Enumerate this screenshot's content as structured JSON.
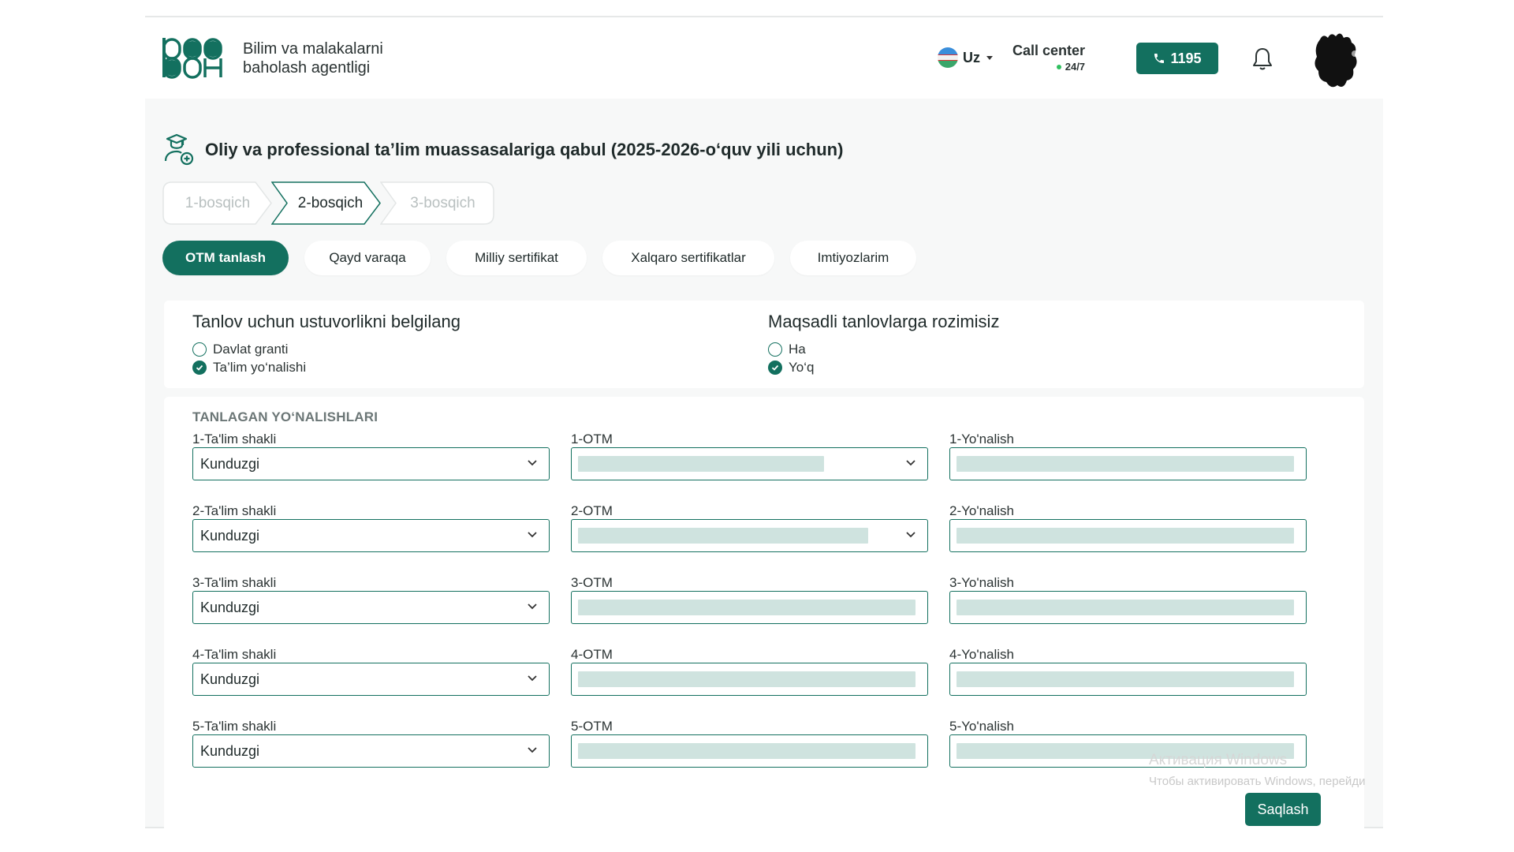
{
  "header": {
    "brand_line1": "Bilim va malakalarni",
    "brand_line2": "baholash agentligi",
    "language": "Uz",
    "call_center_title": "Call center",
    "call_center_hours": "24/7",
    "phone_number": "1195"
  },
  "page": {
    "title": "Oliy va professional ta’lim muassasalariga qabul (2025-2026-o‘quv yili uchun)"
  },
  "steps": [
    {
      "label": "1-bosqich",
      "state": "done"
    },
    {
      "label": "2-bosqich",
      "state": "active"
    },
    {
      "label": "3-bosqich",
      "state": "pending"
    }
  ],
  "tabs": [
    {
      "label": "OTM tanlash",
      "active": true
    },
    {
      "label": "Qayd varaqa",
      "active": false
    },
    {
      "label": "Milliy sertifikat",
      "active": false
    },
    {
      "label": "Xalqaro sertifikatlar",
      "active": false
    },
    {
      "label": "Imtiyozlarim",
      "active": false
    }
  ],
  "priority": {
    "title": "Tanlov uchun ustuvorlikni belgilang",
    "options": [
      {
        "label": "Davlat granti",
        "checked": false
      },
      {
        "label": "Ta’lim yo‘nalishi",
        "checked": true
      }
    ]
  },
  "targeted": {
    "title": "Maqsadli tanlovlarga rozimisiz",
    "options": [
      {
        "label": "Ha",
        "checked": false
      },
      {
        "label": "Yo‘q",
        "checked": true
      }
    ]
  },
  "selections": {
    "title": "TANLAGAN YO‘NALISHLARI",
    "rows": [
      {
        "form_label": "1-Ta'lim shakli",
        "form_value": "Kunduzgi",
        "otm_label": "1-OTM",
        "direction_label": "1-Yo'nalish"
      },
      {
        "form_label": "2-Ta'lim shakli",
        "form_value": "Kunduzgi",
        "otm_label": "2-OTM",
        "direction_label": "2-Yo'nalish"
      },
      {
        "form_label": "3-Ta'lim shakli",
        "form_value": "Kunduzgi",
        "otm_label": "3-OTM",
        "direction_label": "3-Yo'nalish"
      },
      {
        "form_label": "4-Ta'lim shakli",
        "form_value": "Kunduzgi",
        "otm_label": "4-OTM",
        "direction_label": "4-Yo'nalish"
      },
      {
        "form_label": "5-Ta'lim shakli",
        "form_value": "Kunduzgi",
        "otm_label": "5-OTM",
        "direction_label": "5-Yo'nalish"
      }
    ],
    "save_label": "Saqlash"
  },
  "watermark": {
    "line1": "Активация Windows",
    "line2": "Чтобы активировать Windows, перейди"
  },
  "colors": {
    "accent": "#13705f",
    "blurred_value": "#cfe3df"
  }
}
